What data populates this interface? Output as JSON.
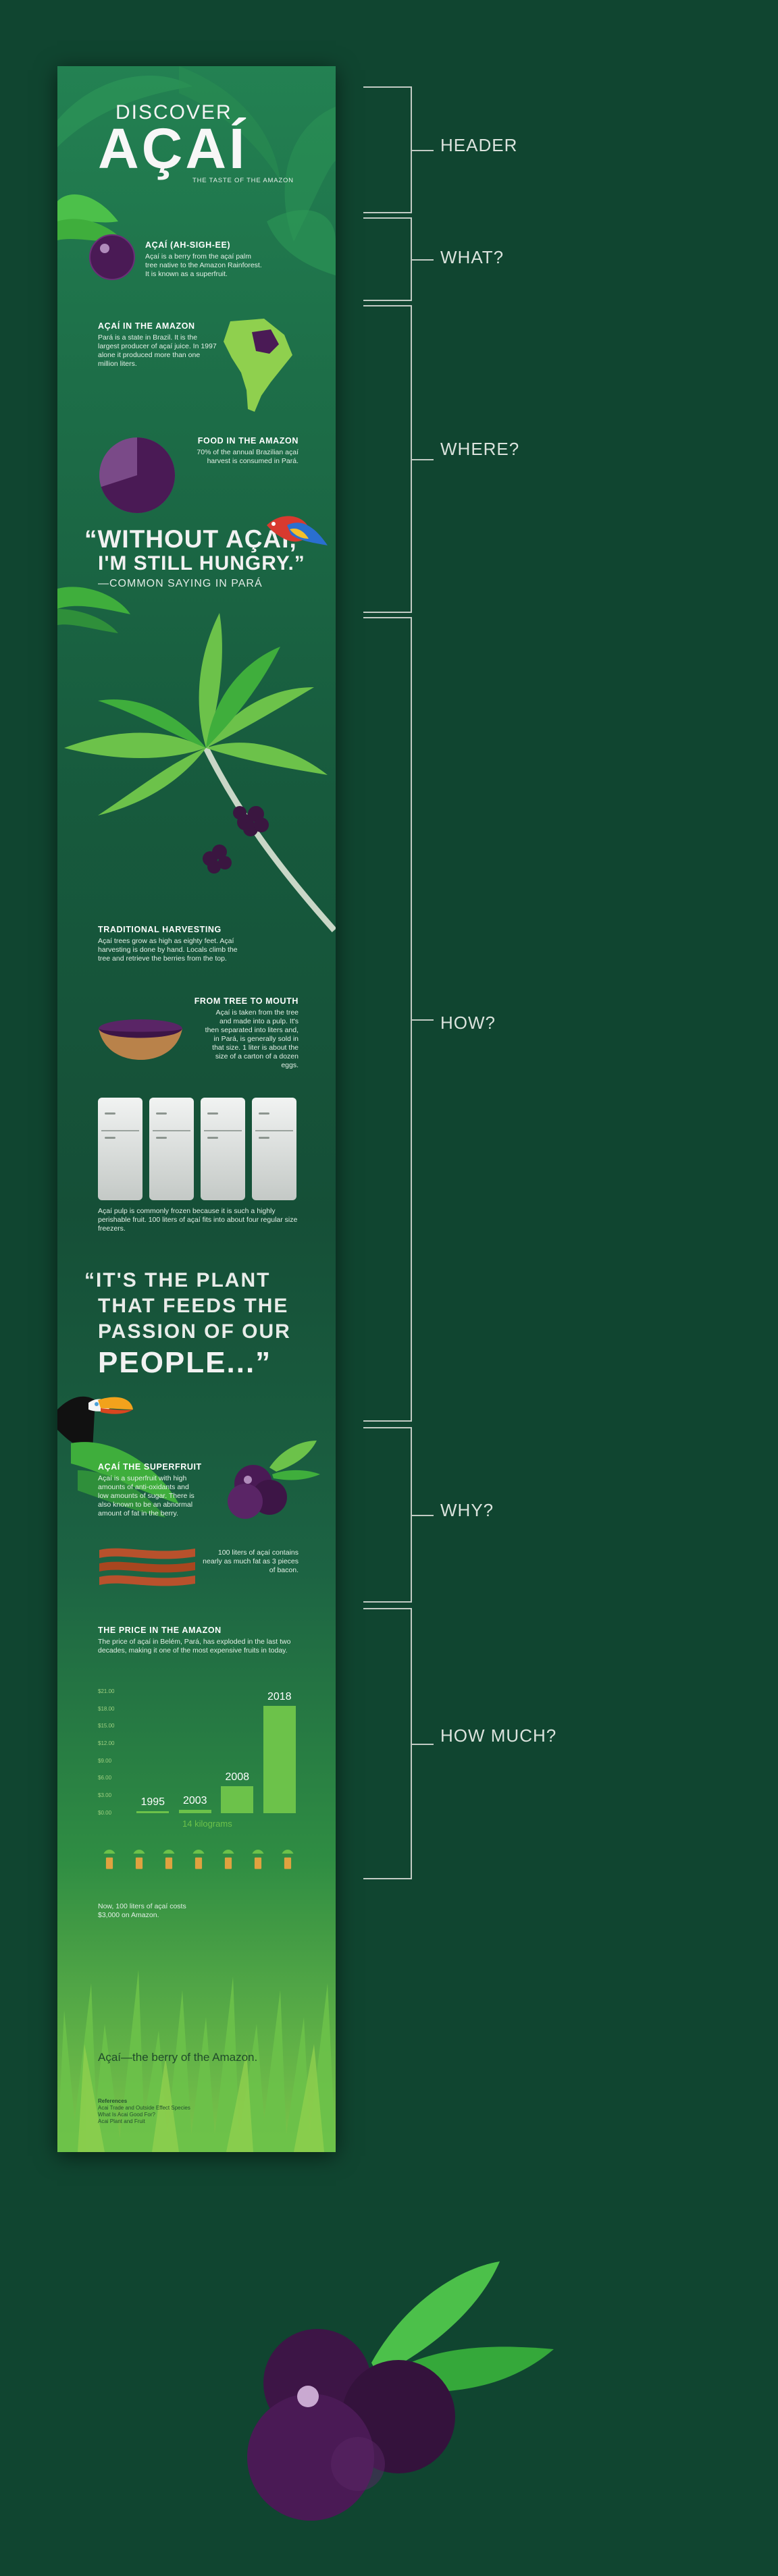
{
  "header": {
    "discover": "DISCOVER",
    "title": "AÇAÍ",
    "tagline": "THE TASTE OF THE AMAZON"
  },
  "what": {
    "heading": "AÇAÍ (AH-SIGH-EE)",
    "body": "Açaí is a berry from the açaí palm tree native to the Amazon Rainforest. It is known as a superfruit."
  },
  "amazon": {
    "heading": "AÇAÍ IN THE AMAZON",
    "body": "Pará is a state in Brazil. It is the largest producer of açaí juice. In 1997 alone it produced more than one million liters."
  },
  "food": {
    "heading": "FOOD IN THE AMAZON",
    "body": "70% of the annual Brazilian açaí harvest is consumed in Pará.",
    "consumed_share": 0.7
  },
  "quote1": {
    "line1": "“WITHOUT AÇAÍ,",
    "line2": "I'M STILL HUNGRY.”",
    "attribution": "—COMMON SAYING IN PARÁ"
  },
  "harvest": {
    "heading": "TRADITIONAL HARVESTING",
    "body": "Açaí trees grow as high as eighty feet. Açaí harvesting is done by hand. Locals climb the tree and retrieve the berries from the top."
  },
  "mouth": {
    "heading": "FROM TREE TO MOUTH",
    "body": "Açaí is taken from the tree and made into a pulp. It's then separated into liters and, in Pará, is generally sold in that size. 1 liter is about the size of a carton of a dozen eggs."
  },
  "frozen": {
    "body": "Açaí pulp is commonly frozen because it is such a highly perishable fruit. 100 liters of açaí fits into about four regular size freezers.",
    "freezer_count": 4
  },
  "quote2": {
    "line1": "“IT'S THE PLANT",
    "line2": "THAT FEEDS THE",
    "line3": "PASSION OF OUR",
    "line4": "PEOPLE...”"
  },
  "superfruit": {
    "heading": "AÇAÍ THE SUPERFRUIT",
    "body": "Açaí is a superfruit with high amounts of anti-oxidants and low amounts of sugar. There is also known to be an abnormal amount of fat in the berry."
  },
  "bacon": {
    "body": "100 liters of açaí contains nearly as much fat as 3 pieces of bacon."
  },
  "price": {
    "heading": "THE PRICE IN THE AMAZON",
    "body": "The price of açaí in Belém, Pará, has exploded in the last two decades, making it one of the most expensive fruits in today."
  },
  "chart_data": {
    "type": "bar",
    "categories": [
      "1995",
      "2003",
      "2008",
      "2018"
    ],
    "values": [
      0.4,
      0.6,
      4.7,
      18.5
    ],
    "ylim": [
      0,
      21
    ],
    "y_ticks": [
      "$21.00",
      "$18.00",
      "$15.00",
      "$12.00",
      "$9.00",
      "$6.00",
      "$3.00",
      "$0.00"
    ],
    "xlabel": "14 kilograms",
    "bar_color": "#6cc24a"
  },
  "amazon_price": {
    "body": "Now, 100 liters of açaí costs $3,000 on Amazon.",
    "pot_count": 7
  },
  "closing": {
    "tagline": "Açaí—the berry of the Amazon."
  },
  "references": {
    "title": "References",
    "line1": "Acai Trade and Outside Effect Species",
    "line2": "What Is Acai Good For?",
    "line3": "Acai Plant and Fruit"
  },
  "sections": {
    "header": "HEADER",
    "what": "WHAT?",
    "where": "WHERE?",
    "how": "HOW?",
    "why": "WHY?",
    "how_much": "HOW MUCH?"
  },
  "colors": {
    "page_background": "#104530",
    "berry": "#4a1a55",
    "accent_green": "#6cc24a",
    "leaf": "#3fae3c"
  }
}
